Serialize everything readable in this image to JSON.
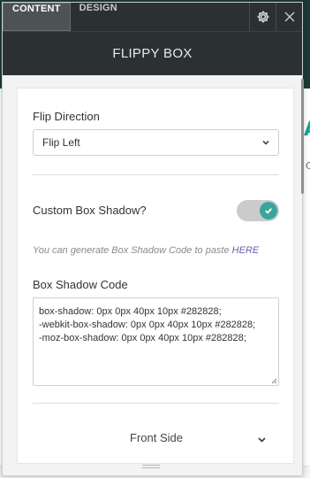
{
  "tabs": [
    {
      "label": "CONTENT",
      "active": true
    },
    {
      "label": "DESIGN",
      "active": false
    }
  ],
  "header": {
    "settings_icon": "gear-icon",
    "close_icon": "close-icon",
    "title": "FLIPPY BOX"
  },
  "form": {
    "flip_direction": {
      "label": "Flip Direction",
      "value": "Flip Left"
    },
    "custom_shadow": {
      "label": "Custom Box Shadow?",
      "enabled": true
    },
    "hint": {
      "text": "You can generate Box Shadow Code to paste ",
      "link": "HERE"
    },
    "shadow_code": {
      "label": "Box Shadow Code",
      "value": "box-shadow: 0px 0px 40px 10px #282828;\n-webkit-box-shadow: 0px 0px 40px 10px #282828;\n-moz-box-shadow: 0px 0px 40px 10px #282828;"
    },
    "section": {
      "label": "Front Side"
    }
  },
  "background": {
    "accent_glyph": "A",
    "side_glyph": "C"
  },
  "colors": {
    "panel_dark": "#2b3133",
    "toggle_on": "#39a59a",
    "link": "#6c5ba9"
  }
}
